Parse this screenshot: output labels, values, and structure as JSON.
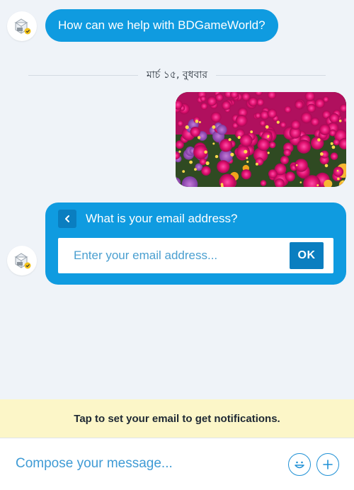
{
  "messages": {
    "greeting": "How can we help with BDGameWorld?",
    "date_separator": "মার্চ ১৫, বুধবার",
    "image_alt_icon": "flower-photo"
  },
  "email_card": {
    "question": "What is your email address?",
    "input_placeholder": "Enter your email address...",
    "ok_label": "OK"
  },
  "notice": {
    "text": "Tap to set your email to get notifications."
  },
  "composer": {
    "placeholder": "Compose your message...",
    "emoji_icon": "smiley-icon",
    "add_icon": "plus-icon"
  },
  "colors": {
    "accent": "#0f9be0",
    "accent_dark": "#0a7ec0",
    "background": "#eff3f8",
    "notice_bg": "#fcf6c8"
  }
}
